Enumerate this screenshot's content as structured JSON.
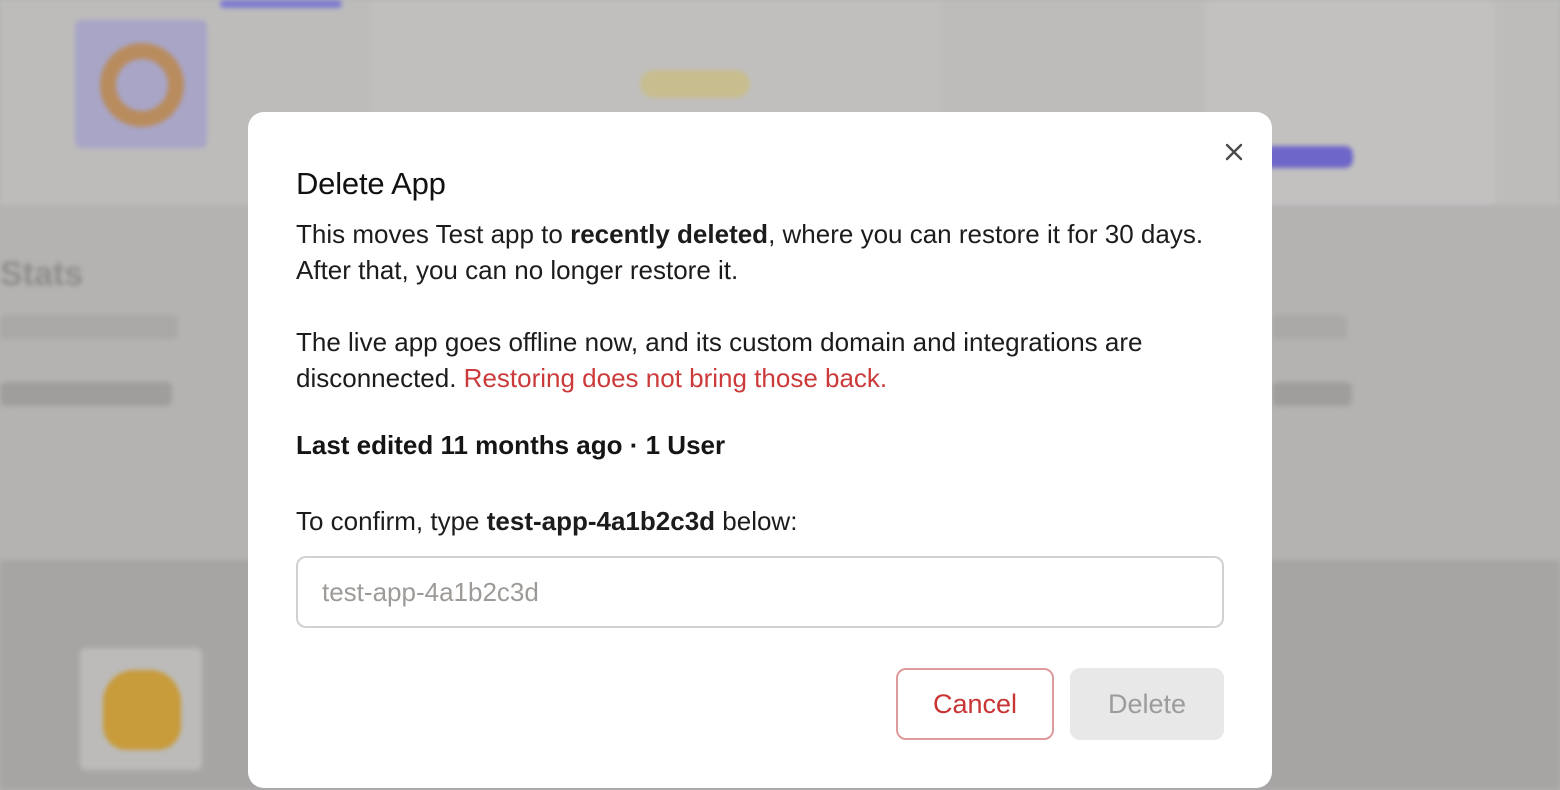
{
  "background": {
    "stats_heading": "Stats"
  },
  "modal": {
    "title": "Delete App",
    "paragraph1": {
      "before": "This moves Test app to ",
      "bold": "recently deleted",
      "after": ", where you can restore it for 30 days. After that, you can no longer restore it."
    },
    "paragraph2": {
      "text": "The live app goes offline now, and its custom domain and integrations are disconnected. ",
      "warning": "Restoring does not bring those back."
    },
    "meta": {
      "last_edited": "Last edited 11 months ago",
      "separator": " · ",
      "users": "1 User"
    },
    "confirm": {
      "before": "To confirm, type ",
      "app_id": "test-app-4a1b2c3d",
      "after": " below:",
      "placeholder": "test-app-4a1b2c3d",
      "value": ""
    },
    "buttons": {
      "cancel_label": "Cancel",
      "delete_label": "Delete"
    },
    "close_icon": "close-icon"
  },
  "colors": {
    "warning": "#cc3b3b",
    "cancel_text": "#c93434",
    "cancel_border": "#df9b9b",
    "delete_disabled_bg": "#e8e8e8",
    "delete_disabled_text": "#9c9c9c",
    "overlay": "#b4b3b2"
  }
}
